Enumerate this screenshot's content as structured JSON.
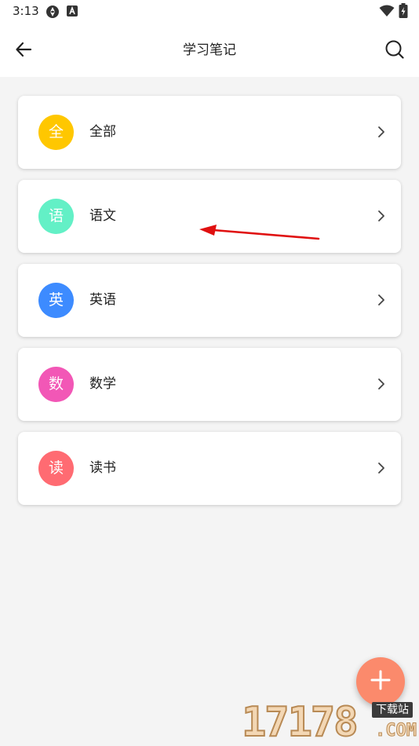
{
  "status_bar": {
    "time": "3:13",
    "icons": [
      "sync-status-icon",
      "notification-a-icon",
      "wifi-icon",
      "battery-charging-icon"
    ]
  },
  "header": {
    "title": "学习笔记",
    "back_icon": "back-arrow-icon",
    "search_icon": "search-icon"
  },
  "categories": [
    {
      "badge": "全",
      "label": "全部",
      "color": "#ffc700"
    },
    {
      "badge": "语",
      "label": "语文",
      "color": "#63f0c6"
    },
    {
      "badge": "英",
      "label": "英语",
      "color": "#3d8bff"
    },
    {
      "badge": "数",
      "label": "数学",
      "color": "#f257b6"
    },
    {
      "badge": "读",
      "label": "读书",
      "color": "#ff6b72"
    }
  ],
  "annotation": {
    "color": "#e01010"
  },
  "fab": {
    "icon": "plus-icon",
    "color": "#fb8a6c"
  },
  "watermark": {
    "digits": "17178",
    "tag": "下载站",
    "suffix": ".COM"
  }
}
